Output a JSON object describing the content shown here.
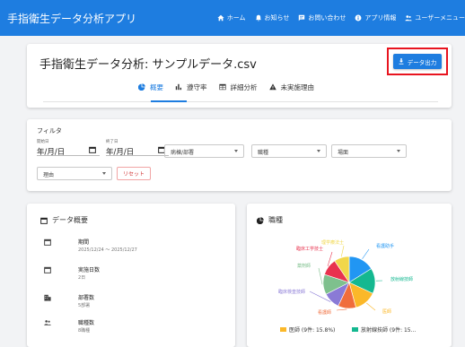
{
  "app": {
    "title": "手指衛生データ分析アプリ",
    "nav": [
      {
        "label": "ホーム",
        "icon": "home-icon"
      },
      {
        "label": "お知らせ",
        "icon": "bell-icon"
      },
      {
        "label": "お問い合わせ",
        "icon": "chat-icon"
      },
      {
        "label": "アプリ情報",
        "icon": "info-icon"
      },
      {
        "label": "ユーザーメニュー",
        "icon": "users-icon"
      }
    ]
  },
  "page": {
    "title": "手指衛生データ分析: サンプルデータ.csv",
    "export_label": "データ出力",
    "tabs": [
      {
        "label": "概要",
        "icon": "pie-chart-icon",
        "active": true
      },
      {
        "label": "遵守率",
        "icon": "bar-chart-icon",
        "active": false
      },
      {
        "label": "詳細分析",
        "icon": "table-icon",
        "active": false
      },
      {
        "label": "未実施理由",
        "icon": "warning-icon",
        "active": false
      }
    ]
  },
  "filter": {
    "title": "フィルタ",
    "start_label": "開始日",
    "start_value": "年/月/日",
    "end_label": "終了日",
    "end_value": "年/月/日",
    "selects": {
      "ward": "病棟/部署",
      "occupation": "職種",
      "scene": "場面",
      "reason": "理由"
    },
    "reset_label": "リセット"
  },
  "overview": {
    "title": "データ概要",
    "items": [
      {
        "icon": "calendar-icon",
        "label": "期間",
        "value": "2025/12/24 〜 2025/12/27"
      },
      {
        "icon": "calendar-icon",
        "label": "実施日数",
        "value": "2日"
      },
      {
        "icon": "building-icon",
        "label": "部署数",
        "value": "5部署"
      },
      {
        "icon": "people-icon",
        "label": "職種数",
        "value": "8職種"
      }
    ]
  },
  "occupation": {
    "title": "職種"
  },
  "colors": {
    "primary": "#1e7de0",
    "highlight": "#e8141f",
    "reset": "#d23a3a"
  },
  "chart_data": {
    "type": "pie",
    "title": "",
    "slices": [
      {
        "name": "看護助手",
        "color": "#2196f3"
      },
      {
        "name": "放射線技師",
        "color": "#14b890"
      },
      {
        "name": "医師",
        "color": "#fbb829"
      },
      {
        "name": "看護師",
        "color": "#f06d3c"
      },
      {
        "name": "臨床検査技師",
        "color": "#8a7ad6"
      },
      {
        "name": "薬剤師",
        "color": "#7ec08d"
      },
      {
        "name": "臨床工学技士",
        "color": "#e8324e"
      },
      {
        "name": "理学療法士",
        "color": "#f1d74a"
      }
    ],
    "legend": [
      {
        "text": "医師 (9件: 15.8%)",
        "color": "#fbb829"
      },
      {
        "text": "放射線技師 (9件: 15...",
        "color": "#14b890"
      }
    ]
  }
}
